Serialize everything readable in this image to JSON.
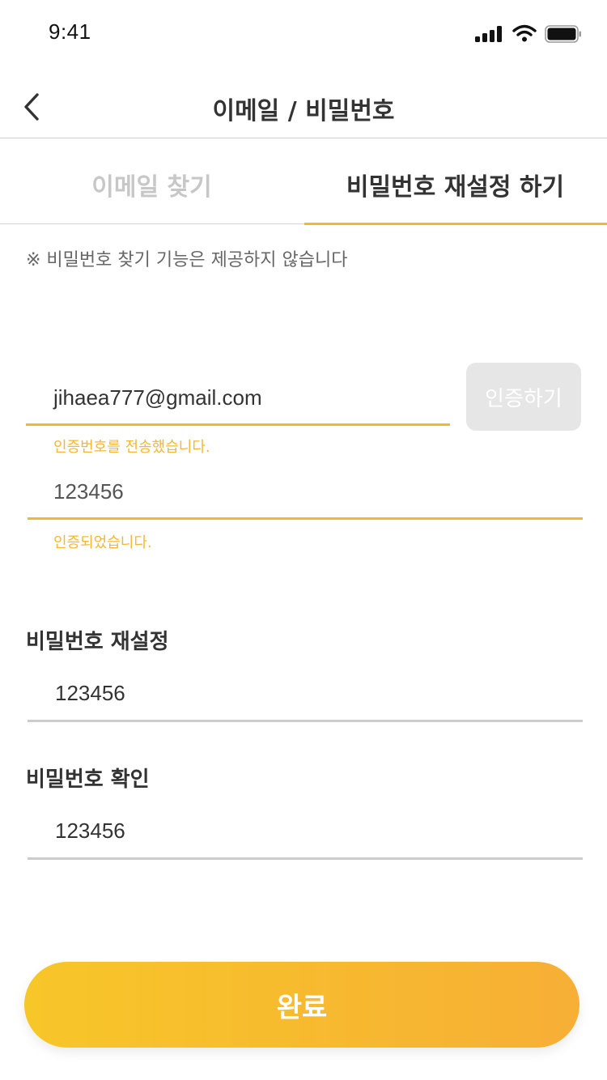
{
  "status_bar": {
    "time": "9:41"
  },
  "header": {
    "title": "이메일 / 비밀번호"
  },
  "tabs": [
    {
      "label": "이메일 찾기",
      "active": false
    },
    {
      "label": "비밀번호 재설정 하기",
      "active": true
    }
  ],
  "notice": "※ 비밀번호 찾기 기능은 제공하지 않습니다",
  "email": {
    "value": "jihaea777@gmail.com",
    "verify_label": "인증하기",
    "message": "인증번호를 전송했습니다."
  },
  "code": {
    "value": "123456",
    "message": "인증되었습니다."
  },
  "reset": {
    "label": "비밀번호 재설정",
    "value": "123456"
  },
  "confirm": {
    "label": "비밀번호 확인",
    "value": "123456"
  },
  "submit_label": "완료",
  "colors": {
    "accent": "#F5B733",
    "gradient_start": "#F7C628",
    "gradient_end": "#F7AF36",
    "inactive_tab": "#C7C7C7",
    "disabled_button": "#E6E6E6"
  },
  "icons": {
    "back": "chevron-left-icon",
    "signal": "cellular-signal-icon",
    "wifi": "wifi-icon",
    "battery": "battery-icon"
  }
}
